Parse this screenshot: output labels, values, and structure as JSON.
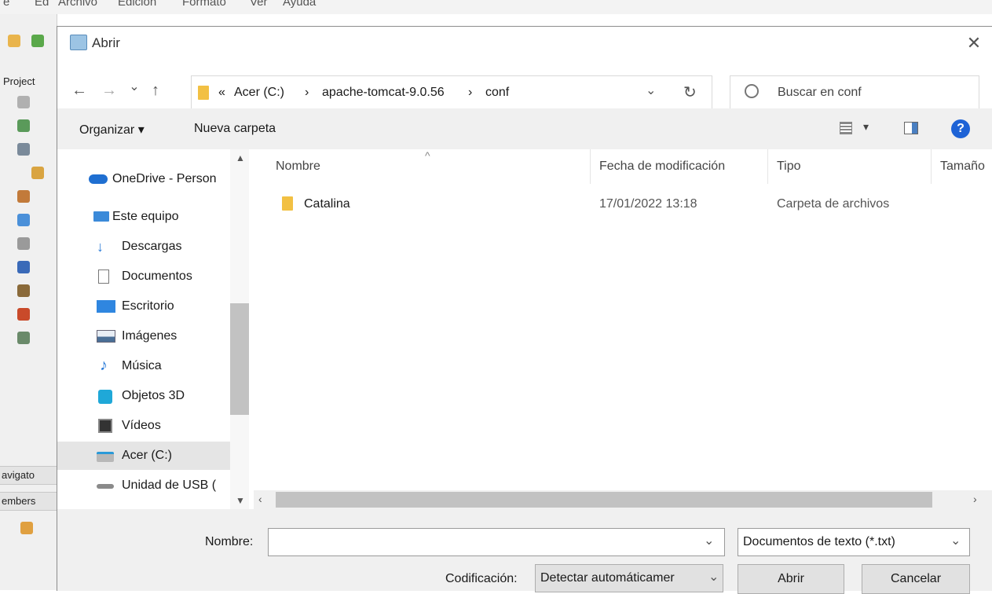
{
  "background_app": {
    "menu": [
      "e",
      "Ed",
      "Archivo",
      "Edición",
      "Formato",
      "Ver",
      "Ayuda"
    ],
    "panels": [
      "Project",
      "avigato",
      "embers"
    ]
  },
  "dialog": {
    "title": "Abrir",
    "close_glyph": "✕"
  },
  "nav": {
    "back": "←",
    "forward": "→",
    "recent": "⌄",
    "up": "↑",
    "breadcrumb": [
      "«",
      "Acer (C:)",
      "›",
      "apache-tomcat-9.0.56",
      "›",
      "conf"
    ],
    "dropdown": "⌄",
    "refresh": "↻",
    "search_placeholder": "Buscar en conf"
  },
  "toolbar": {
    "organize": "Organizar ▾",
    "new_folder": "Nueva carpeta",
    "view_arrow": "▾",
    "help": "?"
  },
  "sidebar": {
    "items": [
      {
        "label": "OneDrive - Person",
        "icon": "cloud-icon"
      },
      {
        "label": "Este equipo",
        "icon": "computer-icon"
      },
      {
        "label": "Descargas",
        "icon": "download-icon"
      },
      {
        "label": "Documentos",
        "icon": "document-icon"
      },
      {
        "label": "Escritorio",
        "icon": "desktop-icon"
      },
      {
        "label": "Imágenes",
        "icon": "pictures-icon"
      },
      {
        "label": "Música",
        "icon": "music-icon"
      },
      {
        "label": "Objetos 3D",
        "icon": "cube-icon"
      },
      {
        "label": "Vídeos",
        "icon": "video-icon"
      },
      {
        "label": "Acer (C:)",
        "icon": "drive-icon"
      },
      {
        "label": "Unidad de USB (",
        "icon": "usb-drive-icon"
      }
    ]
  },
  "files": {
    "columns": [
      "Nombre",
      "Fecha de modificación",
      "Tipo",
      "Tamaño"
    ],
    "sort_glyph": "^",
    "rows": [
      {
        "name": "Catalina",
        "date": "17/01/2022 13:18",
        "type": "Carpeta de archivos",
        "size": ""
      }
    ]
  },
  "bottom": {
    "name_label": "Nombre:",
    "name_value": "",
    "filter": "Documentos de texto (*.txt)",
    "encoding_label": "Codificación:",
    "encoding_value": "Detectar automáticamer",
    "open": "Abrir",
    "cancel": "Cancelar"
  },
  "colors": {
    "accent": "#1e63d6",
    "folder": "#f2c043",
    "selection": "#e5e5e5"
  }
}
